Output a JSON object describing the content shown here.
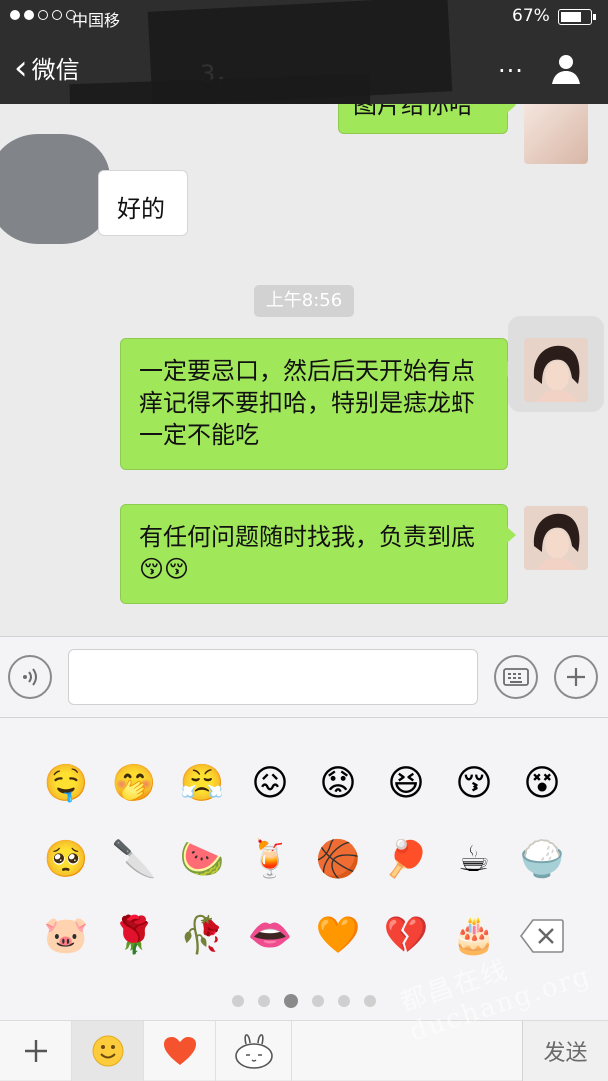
{
  "status_bar": {
    "carrier": "中国移",
    "battery": "67%",
    "accent": "#ffffff"
  },
  "nav": {
    "back_label": "微信",
    "title": "3，",
    "more": "...",
    "profile_icon": "person-icon"
  },
  "messages": [
    {
      "direction": "out",
      "text": "图片给你哈"
    },
    {
      "direction": "in",
      "text": "好的"
    },
    {
      "direction": "time",
      "text": "上午8:56"
    },
    {
      "direction": "out",
      "text": "一定要忌口，然后后天开始有点痒记得不要扣哈，特别是痣龙虾一定不能吃"
    },
    {
      "direction": "out",
      "text": "有任何问题随时找我，负责到底😚😚"
    }
  ],
  "input_bar": {
    "voice_icon": "voice-icon",
    "placeholder": "",
    "keyboard_icon": "keyboard-icon",
    "add_icon": "plus-icon"
  },
  "emoji_panel": {
    "rows": [
      [
        "🤤",
        "🤭",
        "😤",
        "😖",
        "😟",
        "😆",
        "😚",
        "😵"
      ],
      [
        "🥺",
        "🔪",
        "🍉",
        "🍹",
        "🏀",
        "🏓",
        "☕",
        "🍚"
      ],
      [
        "🐷",
        "🌹",
        "🥀",
        "👄",
        "🧡",
        "💔",
        "🎂",
        "delete-icon"
      ]
    ],
    "page_count": 6,
    "active_page": 3
  },
  "tab_bar": {
    "tabs": [
      "plus-icon",
      "smiley-icon",
      "heart-icon",
      "rabbit-sticker-icon"
    ],
    "send_label": "发送"
  },
  "watermark": "都昌在线 duchang.org",
  "colors": {
    "bubble_out": "#a0e75a",
    "bubble_in": "#ffffff",
    "nav_bg": "#2e2e2e",
    "chat_bg": "#ebebeb"
  }
}
